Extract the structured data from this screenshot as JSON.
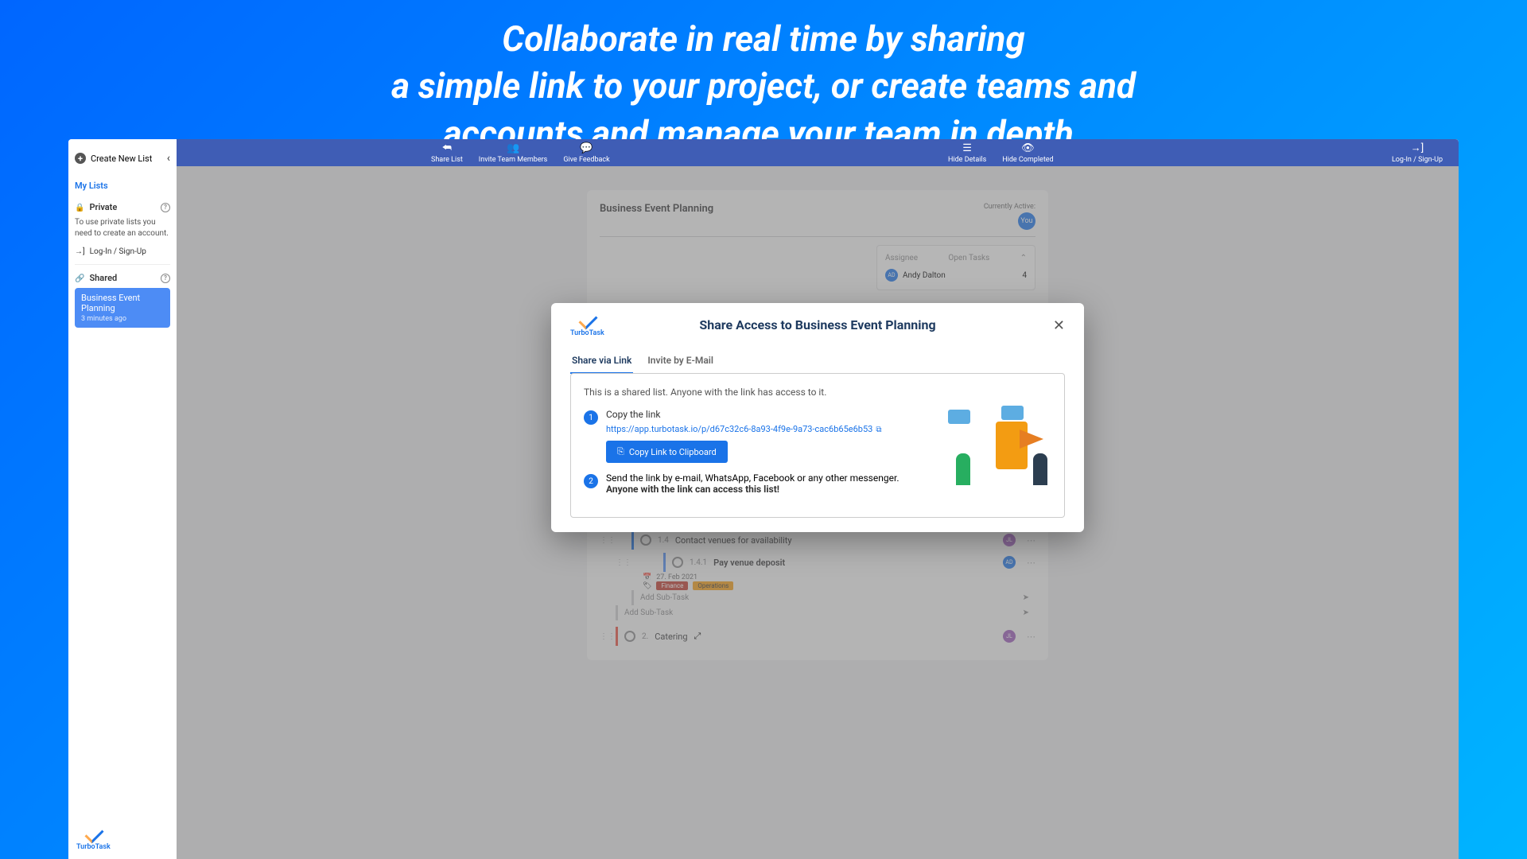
{
  "hero": "Collaborate in real time by sharing\na simple link to your project, or create teams and\naccounts and manage your team in depth.",
  "brand": "TurboTask",
  "sidebar": {
    "create": "Create New List",
    "mylists": "My Lists",
    "private": "Private",
    "private_msg": "To use private lists you need to create an account.",
    "login": "Log-In / Sign-Up",
    "shared": "Shared",
    "list_name": "Business Event Planning",
    "list_time": "3 minutes ago"
  },
  "topbar": {
    "share": "Share List",
    "invite": "Invite Team Members",
    "feedback": "Give Feedback",
    "hidedetails": "Hide Details",
    "hidecompleted": "Hide Completed",
    "login": "Log-In / Sign-Up"
  },
  "panel": {
    "title": "Business Event Planning",
    "active_label": "Currently Active:",
    "you": "You",
    "assignee_hdr": "Assignee",
    "opentasks_hdr": "Open Tasks",
    "assignees": [
      {
        "initials": "AD",
        "name": "Andy Dalton",
        "count": "4"
      }
    ],
    "tasks": {
      "t14_num": "1.4",
      "t14": "Contact venues for availability",
      "t141_num": "1.4.1",
      "t141": "Pay venue deposit",
      "t141_date": "27. Feb 2021",
      "tag_fin": "Finance",
      "tag_ops": "Operations",
      "t2_num": "2.",
      "t2": "Catering",
      "addsub": "Add Sub-Task"
    }
  },
  "modal": {
    "title": "Share Access to Business Event Planning",
    "tab1": "Share via Link",
    "tab2": "Invite by E-Mail",
    "desc": "This is a shared list. Anyone with the link has access to it.",
    "step1_title": "Copy the link",
    "link": "https://app.turbotask.io/p/d67c32c6-8a93-4f9e-9a73-cac6b65e6b53",
    "copy_btn": "Copy Link to Clipboard",
    "step2_text": "Send the link by e-mail, WhatsApp, Facebook or any other messenger.",
    "step2_warn": "Anyone with the link can access this list!"
  }
}
